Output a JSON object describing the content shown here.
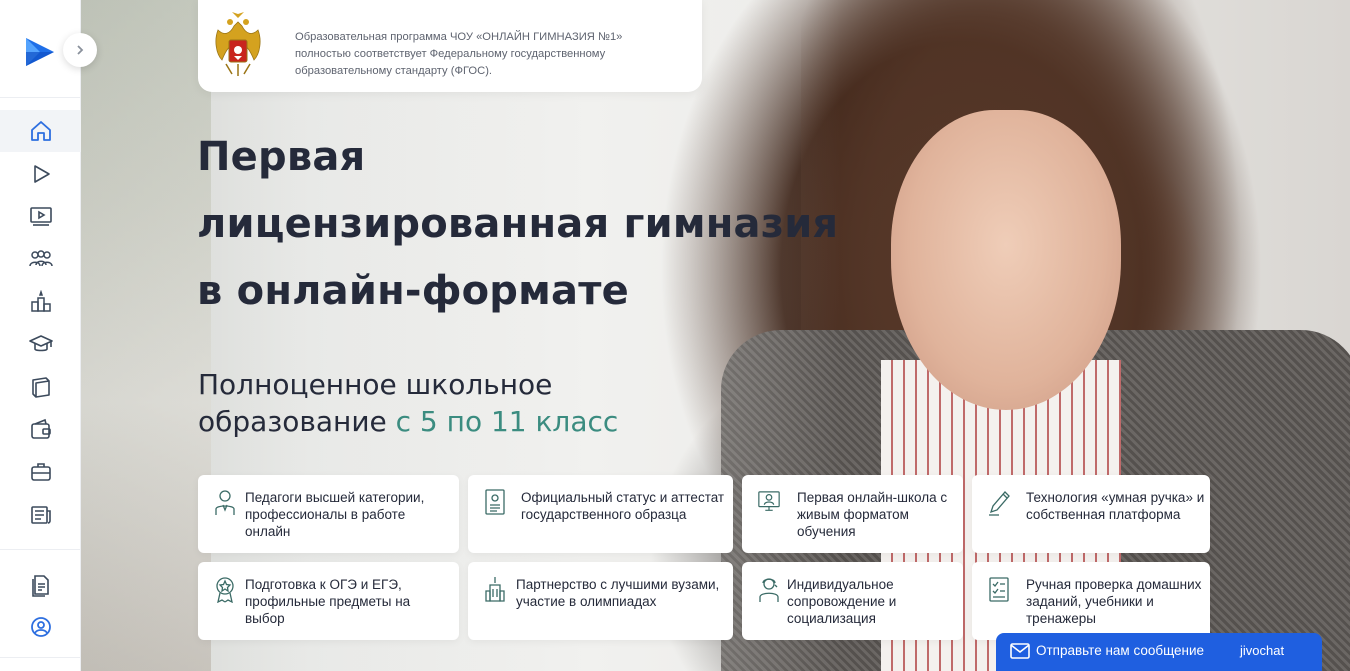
{
  "sidebar": {
    "logo": "play-logo",
    "items": [
      {
        "icon": "home-icon",
        "active": true
      },
      {
        "icon": "play-icon",
        "active": false
      },
      {
        "icon": "video-screen-icon",
        "active": false
      },
      {
        "icon": "people-group-icon",
        "active": false
      },
      {
        "icon": "podium-icon",
        "active": false
      },
      {
        "icon": "graduation-cap-icon",
        "active": false
      },
      {
        "icon": "book-icon",
        "active": false
      },
      {
        "icon": "wallet-icon",
        "active": false
      },
      {
        "icon": "briefcase-icon",
        "active": false
      },
      {
        "icon": "newspaper-icon",
        "active": false
      }
    ],
    "bottom_items": [
      {
        "icon": "documents-icon"
      },
      {
        "icon": "user-circle-icon"
      }
    ],
    "collapse_icon": "chevron-right-icon"
  },
  "fgos": {
    "text": "Образовательная программа ЧОУ «ОНЛАЙН ГИМНАЗИЯ №1» полностью соответствует Федеральному государственному образовательному стандарту (ФГОС).",
    "emblem": "russian-coat-of-arms"
  },
  "hero": {
    "title_line1": "Первая",
    "title_line2": "лицензированная гимназия",
    "title_line3": "в онлайн-формате",
    "subtitle_line1": "Полноценное школьное",
    "subtitle_line2_prefix": "образование ",
    "subtitle_accent": "с 5 по 11 класс"
  },
  "features": [
    {
      "icon": "teacher-icon",
      "text": "Педагоги высшей категории, профессионалы в работе онлайн"
    },
    {
      "icon": "certificate-icon",
      "text": "Официальный статус и аттестат государственного образца"
    },
    {
      "icon": "live-lesson-icon",
      "text": "Первая онлайн-школа с живым форматом обучения"
    },
    {
      "icon": "smart-pen-icon",
      "text": "Технология «умная ручка» и собственная платформа"
    },
    {
      "icon": "medal-icon",
      "text": "Подготовка к ОГЭ и ЕГЭ, профильные предметы на выбор"
    },
    {
      "icon": "university-icon",
      "text": "Партнерство с лучшими вузами, участие в олимпиадах"
    },
    {
      "icon": "support-person-icon",
      "text": "Индивидуальное сопровождение и социализация"
    },
    {
      "icon": "checklist-icon",
      "text": "Ручная проверка домашних заданий, учебники и тренажеры"
    }
  ],
  "jivochat": {
    "label": "Отправьте нам сообщение",
    "brand": "jivochat"
  },
  "colors": {
    "accent_teal": "#3b8c80",
    "heading": "#252a3a",
    "sidebar_icon": "#3c4a5c",
    "logo_blue": "#1f6fe8",
    "jivo_blue": "#1f5fe0"
  }
}
